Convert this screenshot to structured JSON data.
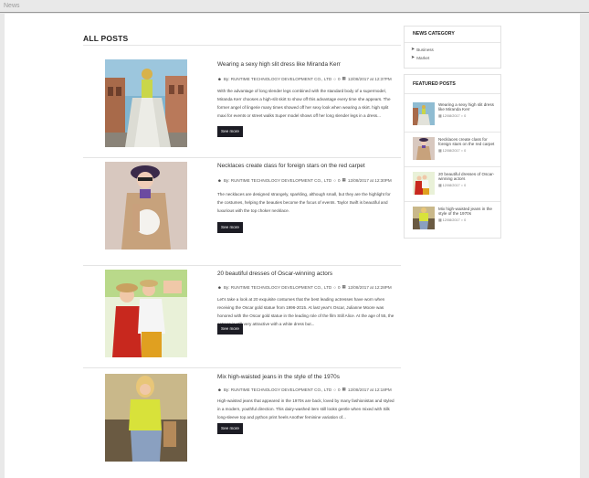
{
  "browser": {
    "tab_label": "News"
  },
  "main": {
    "title": "ALL POSTS"
  },
  "posts": [
    {
      "title": "Wearing a sexy high slit dress like Miranda Kerr",
      "meta_author": "By: RUNTIME TECHNOLOGY DEVELOPMENT CO., LTD",
      "meta_comments": "0",
      "meta_date": "12/08/2017 at 12:37PM",
      "excerpt": "With the advantage of long slender legs combined with the standard body of a supermodel, Miranda Kerr chooses a high-slit skirt to show off this advantage every time she appears. The former angel of lingerie many times showed off her sexy look when wearing a skirt. high split maxi for events or street walks Super model shows off her long slender legs in a dress...",
      "button": "See more"
    },
    {
      "title": "Necklaces create class for foreign stars on the red carpet",
      "meta_author": "By: RUNTIME TECHNOLOGY DEVELOPMENT CO., LTD",
      "meta_comments": "0",
      "meta_date": "12/08/2017 at 12:30PM",
      "excerpt": "The necklaces are designed strangely, sparkling, although small, but they are the highlight for the costumes, helping the beauties become the focus of events. Taylor Swift is beautiful and luxurious with the top choker necklace.",
      "button": "See more"
    },
    {
      "title": "20 beautiful dresses of Oscar-winning actors",
      "meta_author": "By: RUNTIME TECHNOLOGY DEVELOPMENT CO., LTD",
      "meta_comments": "0",
      "meta_date": "12/08/2017 at 12:28PM",
      "excerpt": "Let's take a look at 20 exquisite costumes that the best leading actresses have worn when receiving the Oscar gold statue from 1996-2015. At last year's Oscar, Julianne Moore was honored with the Oscar gold statue in the leading role of the film Still Alice. At the age of 55, the actress is still very attractive with a white dress but...",
      "button": "See more"
    },
    {
      "title": "Mix high-waisted jeans in the style of the 1970s",
      "meta_author": "By: RUNTIME TECHNOLOGY DEVELOPMENT CO., LTD",
      "meta_comments": "0",
      "meta_date": "12/08/2017 at 12:18PM",
      "excerpt": "High-waisted jeans that appeared in the 1970s are back, loved by many fashionistas and styled in a modern, youthful direction. This dairy-washed item still looks gentle when mixed with Silk long-sleeve top and python print heels Another feminine variation of...",
      "button": "See more"
    }
  ],
  "sidebar": {
    "news_category": {
      "title": "NEWS CATEGORY",
      "items": [
        "Business",
        "Market"
      ]
    },
    "featured": {
      "title": "FEATURED POSTS",
      "items": [
        {
          "title": "Wearing a sexy high slit dress like Miranda Kerr",
          "date": "12/08/2017",
          "comments": "0"
        },
        {
          "title": "Necklaces create class for foreign stars on the red carpet",
          "date": "12/08/2017",
          "comments": "0"
        },
        {
          "title": "20 beautiful dresses of Oscar-winning actors",
          "date": "12/08/2017",
          "comments": "0"
        },
        {
          "title": "Mix high-waisted jeans in the style of the 1970s",
          "date": "12/08/2017",
          "comments": "0"
        }
      ]
    }
  },
  "icons": {
    "user": "user-icon",
    "comment": "comment-icon",
    "calendar": "calendar-icon",
    "category": "circle-arrow-icon"
  }
}
